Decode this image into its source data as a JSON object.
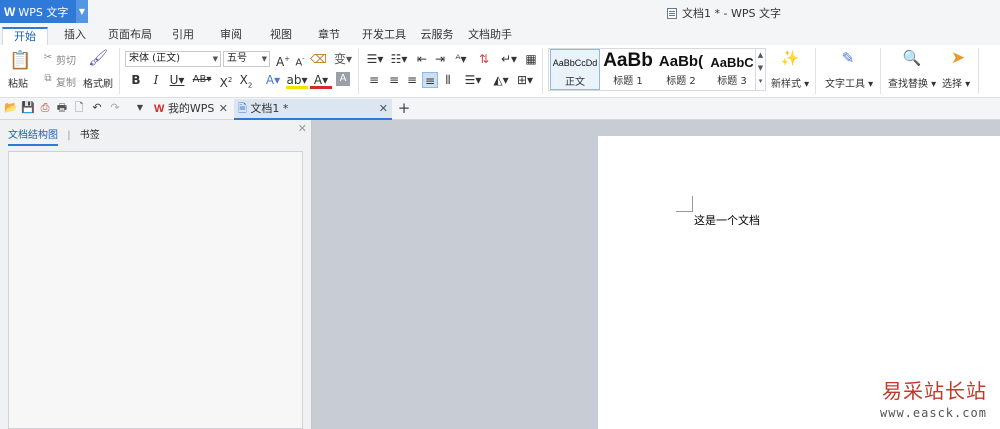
{
  "app": {
    "name": "WPS 文字",
    "window_title": "文档1 * - WPS 文字"
  },
  "menu_tabs": [
    "开始",
    "插入",
    "页面布局",
    "引用",
    "审阅",
    "视图",
    "章节",
    "开发工具",
    "云服务",
    "文档助手"
  ],
  "ribbon": {
    "paste": "粘贴",
    "cut": "剪切",
    "copy": "复制",
    "format_painter": "格式刷",
    "font_name": "宋体 (正文)",
    "font_size": "五号",
    "styles": [
      {
        "sample": "AaBbCcDd",
        "name": "正文"
      },
      {
        "sample": "AaBb",
        "name": "标题 1"
      },
      {
        "sample": "AaBb(",
        "name": "标题 2"
      },
      {
        "sample": "AaBbC",
        "name": "标题 3"
      }
    ],
    "new_style": "新样式",
    "text_tools": "文字工具",
    "find_replace": "查找替换",
    "select": "选择"
  },
  "doc_tabs": {
    "mywps": "我的WPS",
    "doc1": "文档1 *"
  },
  "nav_pane": {
    "tab_outline": "文档结构图",
    "tab_bookmark": "书签"
  },
  "document": {
    "text": "这是一个文档"
  },
  "watermark": {
    "cn": "易采站长站",
    "url": "www.easck.com"
  }
}
